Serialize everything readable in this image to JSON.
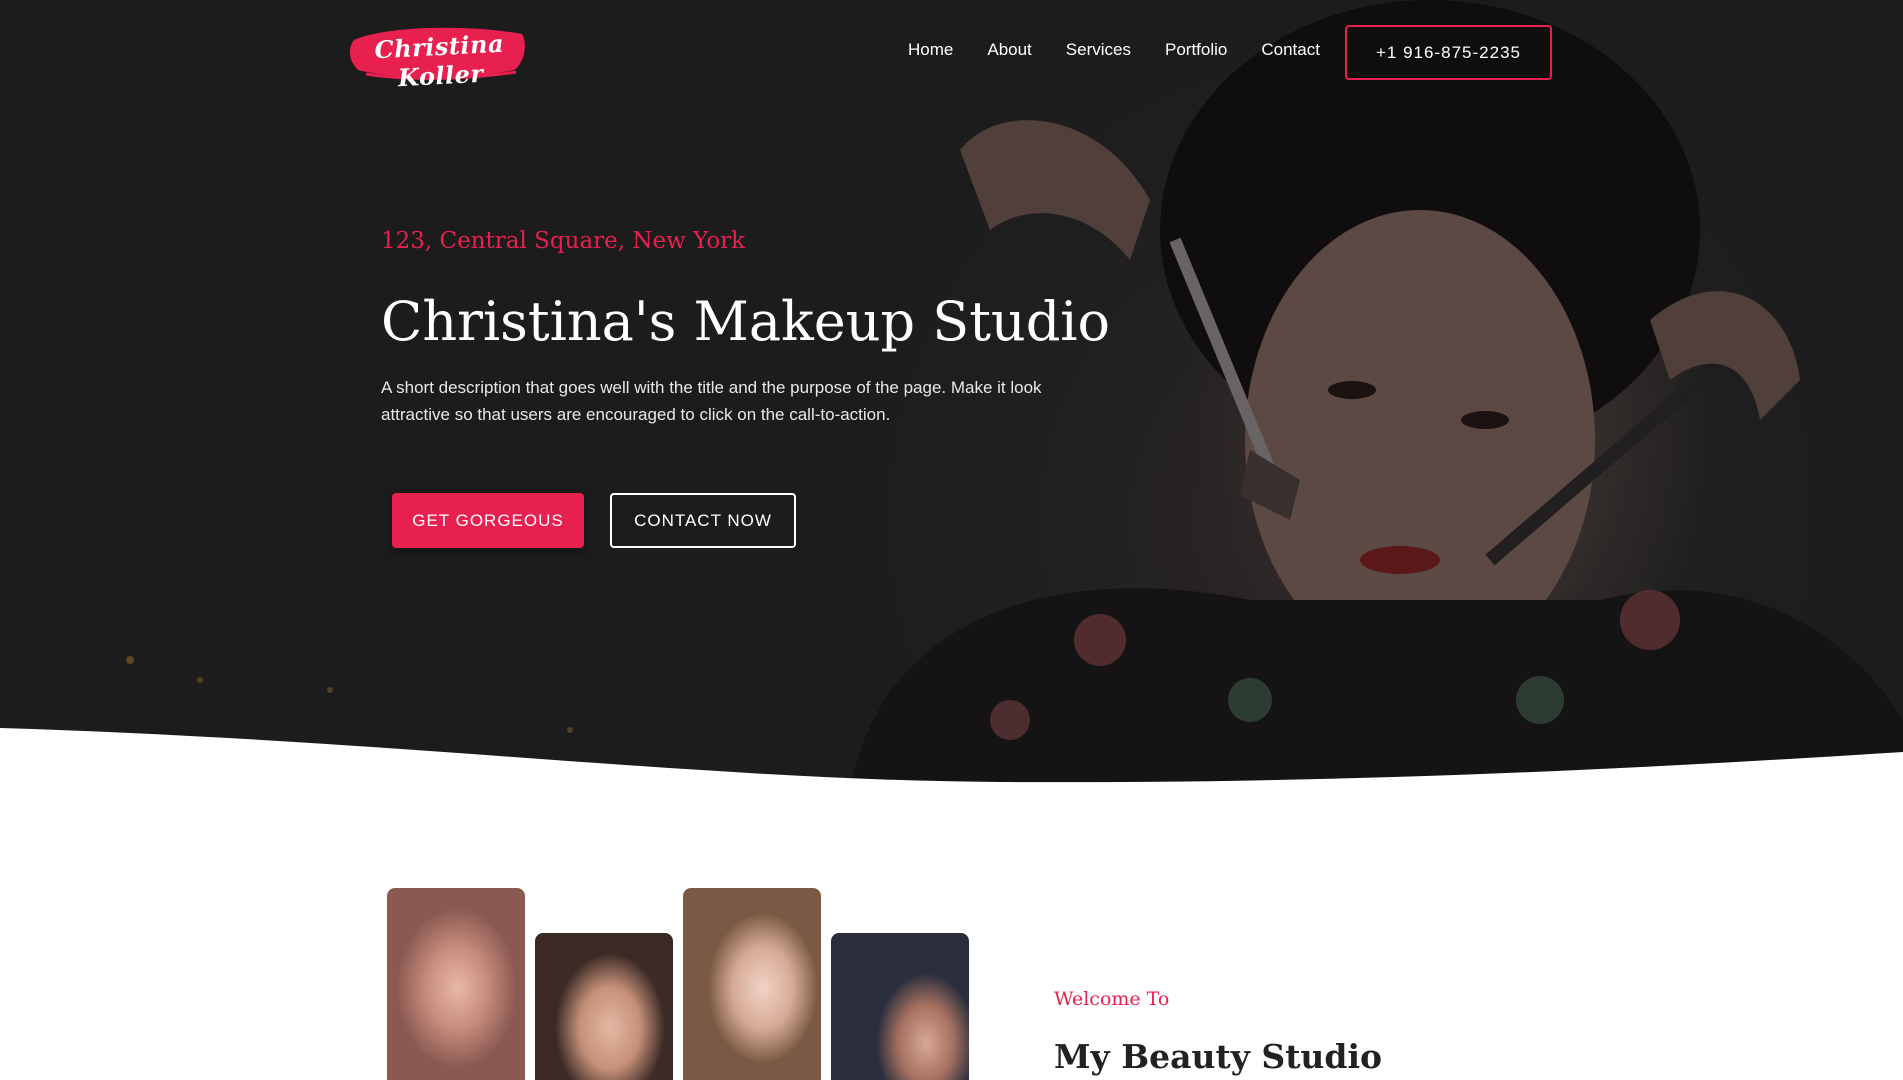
{
  "brand": {
    "logo_text": "Christina Koller",
    "accent_color": "#e8204f"
  },
  "nav": {
    "items": [
      {
        "label": "Home"
      },
      {
        "label": "About"
      },
      {
        "label": "Services"
      },
      {
        "label": "Portfolio"
      },
      {
        "label": "Contact"
      }
    ],
    "phone_label": "+1 916-875-2235"
  },
  "hero": {
    "address": "123, Central Square, New York",
    "title": "Christina's Makeup Studio",
    "description": "A short description that goes well with the title and the purpose of the page. Make it look attractive so that users are encouraged to click on the call-to-action.",
    "primary_button": "GET GORGEOUS",
    "secondary_button": "CONTACT NOW"
  },
  "about": {
    "kicker": "Welcome To",
    "title": "My Beauty Studio"
  }
}
